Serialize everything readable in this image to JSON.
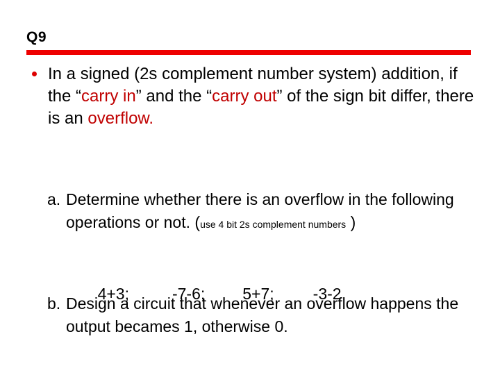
{
  "slide": {
    "title": "Q9",
    "rule_color": "#ee0000",
    "background_color": "#ffffff",
    "accent_red": "#c00000",
    "bullet_color": "#dd0000"
  },
  "main_bullet": {
    "segment_1": "In a signed (2s complement number system) addition,  if the “",
    "highlight_1": "carry in",
    "segment_2": "” and the “",
    "highlight_2": "carry out",
    "segment_3": "” of the sign bit differ, there is an ",
    "highlight_3": "overflow."
  },
  "sub_items": [
    {
      "marker": "a.",
      "segment_1": "Determine whether there is an overflow in the following operations or not. ",
      "paren_open": "(",
      "small_note": "use 4 bit 2s complement numbers",
      "paren_close": " )"
    },
    {
      "marker": "b.",
      "segment_1": "Design a circuit that whenever an overflow happens the output becames 1, otherwise 0."
    }
  ],
  "operations": [
    "4+3;",
    "-7-6;",
    "5+7;",
    "-3-2"
  ]
}
